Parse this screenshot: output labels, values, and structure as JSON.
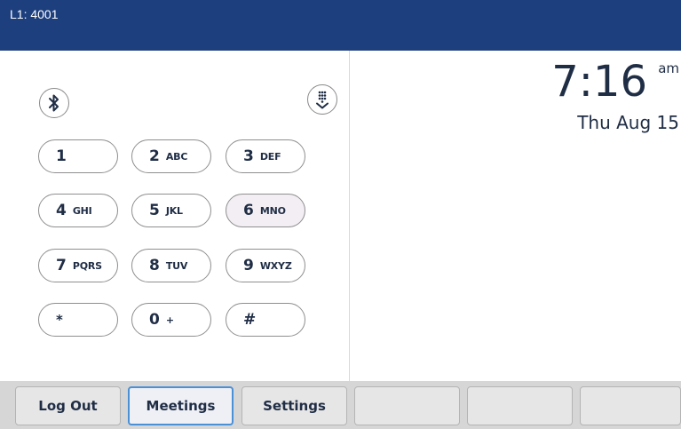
{
  "header": {
    "line_label": "L1: 4001",
    "background": "#1e3f7e"
  },
  "icons": {
    "bluetooth": "bluetooth-icon",
    "dialpad": "dialpad-collapse-icon"
  },
  "dialpad": {
    "keys": [
      {
        "digit": "1",
        "letters": ""
      },
      {
        "digit": "2",
        "letters": "ABC"
      },
      {
        "digit": "3",
        "letters": "DEF"
      },
      {
        "digit": "4",
        "letters": "GHI"
      },
      {
        "digit": "5",
        "letters": "JKL"
      },
      {
        "digit": "6",
        "letters": "MNO"
      },
      {
        "digit": "7",
        "letters": "PQRS"
      },
      {
        "digit": "8",
        "letters": "TUV"
      },
      {
        "digit": "9",
        "letters": "WXYZ"
      },
      {
        "digit": "*",
        "letters": ""
      },
      {
        "digit": "0",
        "letters": "+"
      },
      {
        "digit": "#",
        "letters": ""
      }
    ],
    "highlighted_key": "6"
  },
  "clock": {
    "time": "7:16",
    "ampm": "am",
    "date": "Thu Aug 15"
  },
  "softkeys": {
    "items": [
      {
        "label": "Log Out"
      },
      {
        "label": "Meetings"
      },
      {
        "label": "Settings"
      },
      {
        "label": ""
      },
      {
        "label": ""
      },
      {
        "label": ""
      }
    ],
    "focused": "Meetings",
    "focus_color": "#4a90d6"
  }
}
